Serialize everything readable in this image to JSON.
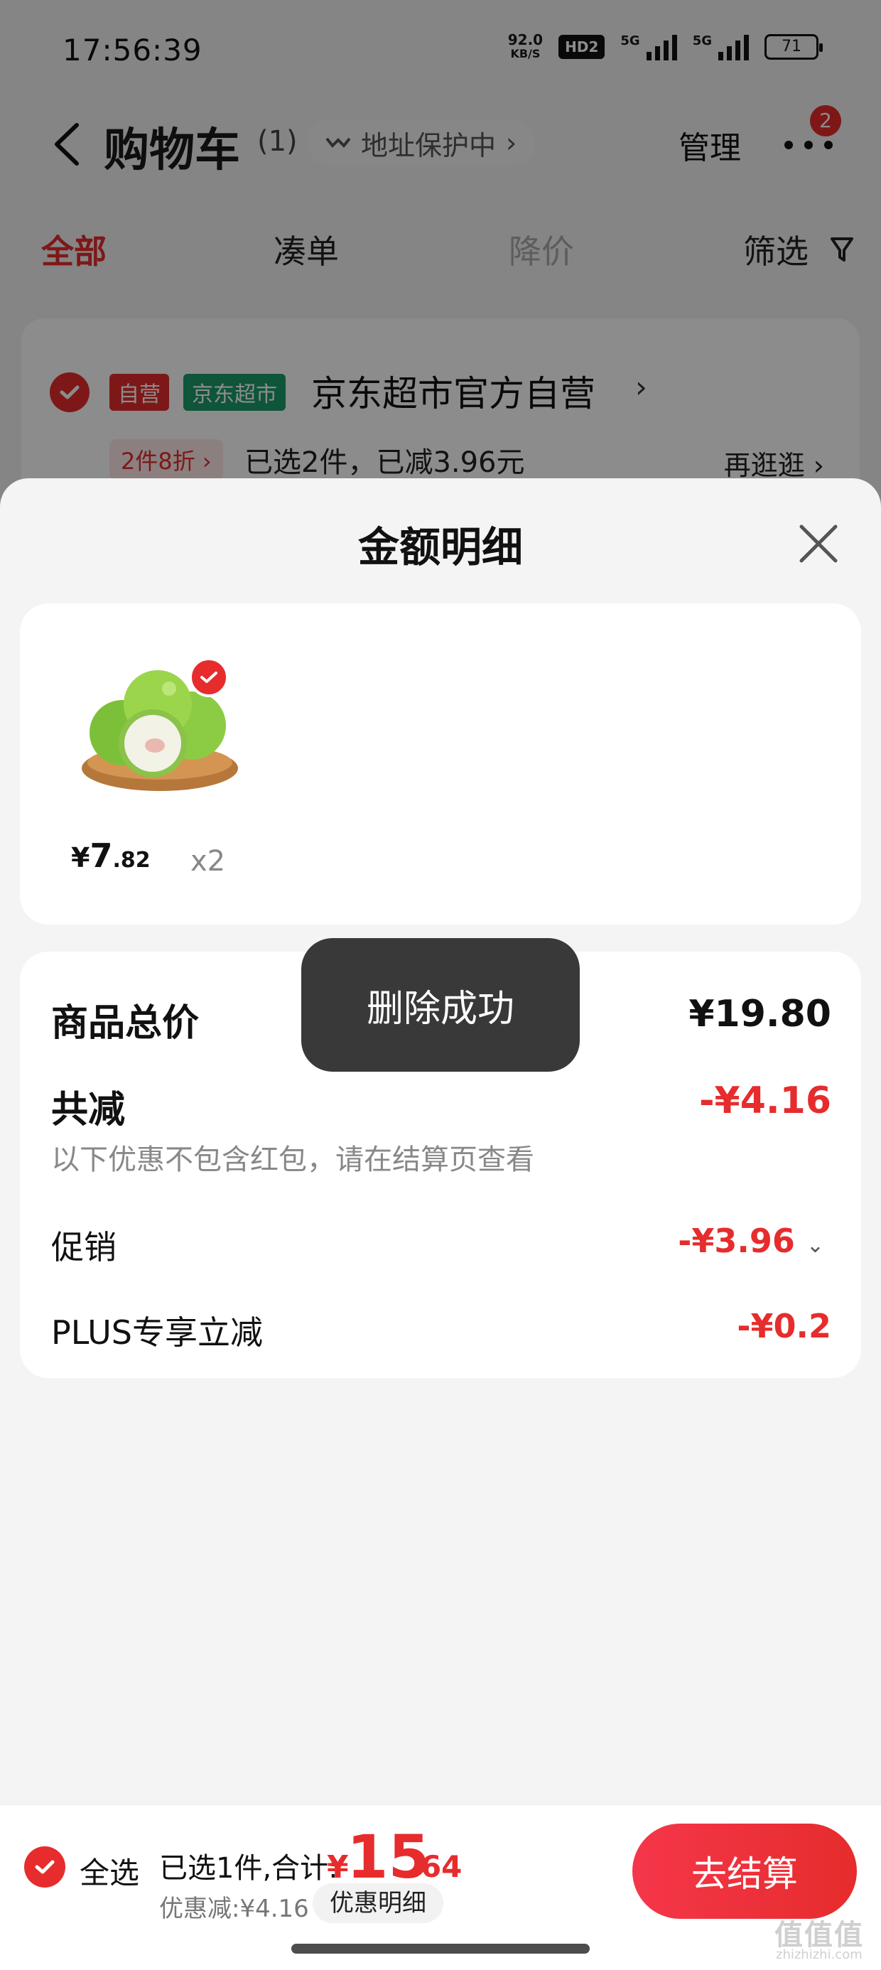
{
  "status_bar": {
    "time": "17:56:39",
    "net_speed_value": "92.0",
    "net_speed_unit": "KB/S",
    "hd": "HD2",
    "signal1": "5G",
    "signal2": "5G",
    "battery": "71"
  },
  "nav": {
    "title": "购物车",
    "count": "(1)",
    "address_protection": "地址保护中",
    "manage": "管理",
    "more_badge": "2"
  },
  "tabs": {
    "all": "全部",
    "combo": "凑单",
    "price_drop": "降价",
    "filter": "筛选"
  },
  "store": {
    "tag_self": "自营",
    "tag_market": "京东超市",
    "name": "京东超市官方自营",
    "promo_tag": "2件8折",
    "promo_text": "已选2件，已减3.96元",
    "shop_more": "再逛逛"
  },
  "sheet": {
    "title": "金额明细",
    "item": {
      "price_yen": "¥",
      "price_int": "7",
      "price_dec": ".82",
      "qty": "x2"
    },
    "summary": {
      "total_label": "商品总价",
      "total_value": "¥19.80",
      "reduce_label": "共减",
      "reduce_value": "-¥4.16",
      "note": "以下优惠不包含红包，请在结算页查看",
      "promo_label": "促销",
      "promo_value": "-¥3.96",
      "plus_label": "PLUS专享立减",
      "plus_value": "-¥0.2"
    },
    "toast": "删除成功"
  },
  "checkout": {
    "select_all": "全选",
    "selected_text": "已选1件,合计:",
    "total_yen": "¥",
    "total_int": "15",
    "total_dec": ".64",
    "discount_text": "优惠减:¥4.16",
    "detail_button": "优惠明细",
    "checkout_button": "去结算"
  },
  "watermark": {
    "main": "值值值",
    "sub": "zhizhizhi.com"
  },
  "colors": {
    "accent": "#e62c2c",
    "market_green": "#1b9b6a"
  }
}
